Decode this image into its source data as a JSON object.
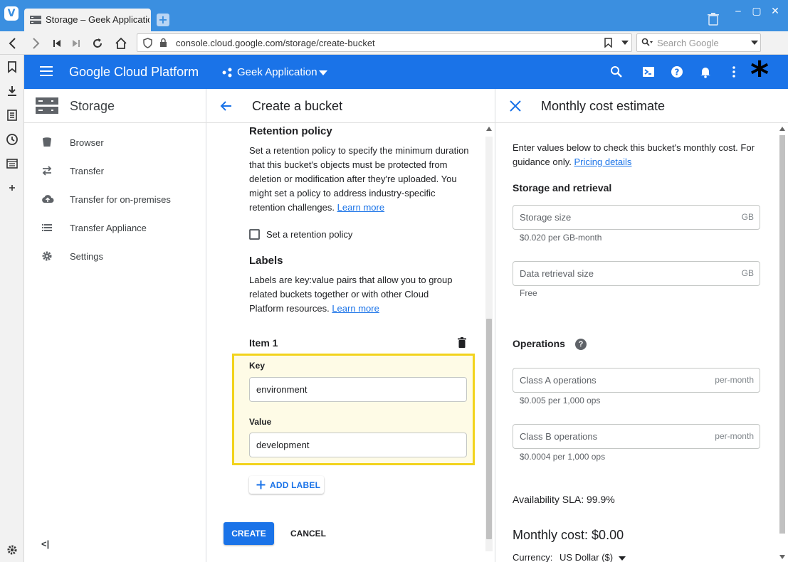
{
  "browser": {
    "tab_title": "Storage – Geek Application",
    "url": "console.cloud.google.com/storage/create-bucket",
    "search_placeholder": "Search Google"
  },
  "header": {
    "app_title": "Google Cloud Platform",
    "project_name": "Geek Application",
    "brand_color": "#1a73e8"
  },
  "leftnav": {
    "title": "Storage",
    "items": [
      {
        "label": "Browser",
        "icon": "bucket-icon"
      },
      {
        "label": "Transfer",
        "icon": "transfer-arrows-icon"
      },
      {
        "label": "Transfer for on-premises",
        "icon": "cloud-upload-icon"
      },
      {
        "label": "Transfer Appliance",
        "icon": "list-icon"
      },
      {
        "label": "Settings",
        "icon": "gear-icon"
      }
    ],
    "collapse_label": "<|"
  },
  "create": {
    "title": "Create a bucket",
    "retention": {
      "heading": "Retention policy",
      "description": "Set a retention policy to specify the minimum duration that this bucket's objects must be protected from deletion or modification after they're uploaded. You might set a policy to address industry-specific retention challenges.",
      "learn_more": "Learn more",
      "checkbox_label": "Set a retention policy",
      "checked": false
    },
    "labels": {
      "heading": "Labels",
      "description": "Labels are key:value pairs that allow you to group related buckets together or with other Cloud Platform resources.",
      "learn_more": "Learn more",
      "item_title": "Item 1",
      "key_label": "Key",
      "key_value": "environment",
      "value_label": "Value",
      "value_value": "development",
      "add_label": "ADD LABEL"
    },
    "create_button": "CREATE",
    "cancel_button": "CANCEL"
  },
  "estimate": {
    "title": "Monthly cost estimate",
    "intro": "Enter values below to check this bucket's monthly cost. For guidance only.",
    "pricing_link": "Pricing details",
    "storage_heading": "Storage and retrieval",
    "storage_size_placeholder": "Storage size",
    "storage_size_suffix": "GB",
    "storage_size_hint": "$0.020 per GB-month",
    "retrieval_placeholder": "Data retrieval size",
    "retrieval_suffix": "GB",
    "retrieval_hint": "Free",
    "operations_heading": "Operations",
    "class_a_placeholder": "Class A operations",
    "class_a_suffix": "per-month",
    "class_a_hint": "$0.005 per 1,000 ops",
    "class_b_placeholder": "Class B operations",
    "class_b_suffix": "per-month",
    "class_b_hint": "$0.0004 per 1,000 ops",
    "availability": "Availability SLA: 99.9%",
    "monthly_cost": "Monthly cost: $0.00",
    "currency_label": "Currency:",
    "currency_value": "US Dollar ($)"
  }
}
